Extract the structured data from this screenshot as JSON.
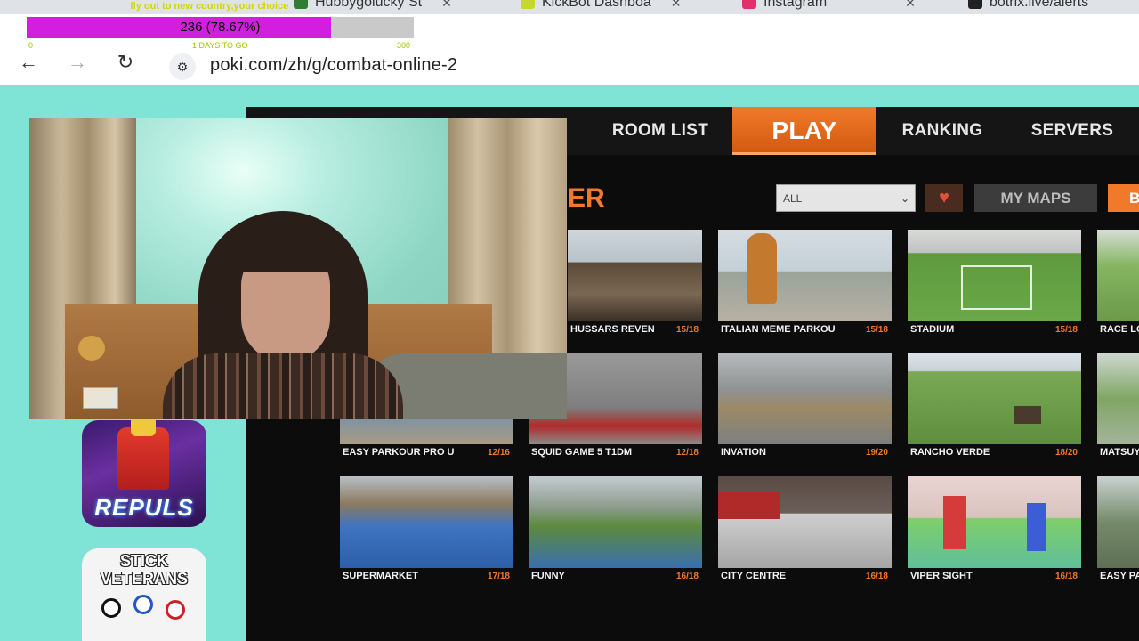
{
  "browser": {
    "tabs": [
      {
        "label": "Hubbygolucky St",
        "favicon_color": "#2e7d32"
      },
      {
        "label": "KickBot Dashboa",
        "favicon_color": "#c7d82b"
      },
      {
        "label": "Instagram",
        "favicon_color": "#e1306c"
      },
      {
        "label": "botrix.live/alerts",
        "favicon_color": "#222222"
      }
    ],
    "url": "poki.com/zh/g/combat-online-2",
    "nav": {
      "back": "←",
      "forward": "→",
      "reload": "↻",
      "site_info": "⚙"
    }
  },
  "overlay": {
    "progress_text": "236 (78.67%)",
    "progress_fraction": 0.7867,
    "note": "fly out to new country,your choice",
    "left_mini": "0",
    "days_mini": "1 DAYS TO GO",
    "right_mini": "300",
    "fill_color": "#d21edd"
  },
  "sidebar": {
    "games": [
      {
        "title": "REPULS"
      },
      {
        "title": "STICK VETERANS"
      }
    ]
  },
  "game": {
    "nav": {
      "room_list": "ROOM LIST",
      "play": "PLAY",
      "ranking": "RANKING",
      "servers": "SERVERS"
    },
    "section_title": "ER",
    "filter": {
      "value": "ALL"
    },
    "my_maps": "MY MAPS",
    "more": "B",
    "accent_color": "#f07a2a",
    "maps": [
      {
        "name": "HUSSARS REVEN",
        "count": "15/18"
      },
      {
        "name": "ITALIAN MEME PARKOU",
        "count": "15/18"
      },
      {
        "name": "STADIUM",
        "count": "15/18"
      },
      {
        "name": "RACE LO",
        "count": ""
      },
      {
        "name": "EASY PARKOUR PRO U",
        "count": "12/16"
      },
      {
        "name": "SQUID GAME 5 T1DM",
        "count": "12/18"
      },
      {
        "name": "INVATION",
        "count": "19/20"
      },
      {
        "name": "RANCHO VERDE",
        "count": "18/20"
      },
      {
        "name": "MATSUY",
        "count": ""
      },
      {
        "name": "SUPERMARKET",
        "count": "17/18"
      },
      {
        "name": "FUNNY",
        "count": "16/18"
      },
      {
        "name": "CITY CENTRE",
        "count": "16/18"
      },
      {
        "name": "VIPER SIGHT",
        "count": "16/18"
      },
      {
        "name": "EASY PA",
        "count": ""
      }
    ]
  }
}
